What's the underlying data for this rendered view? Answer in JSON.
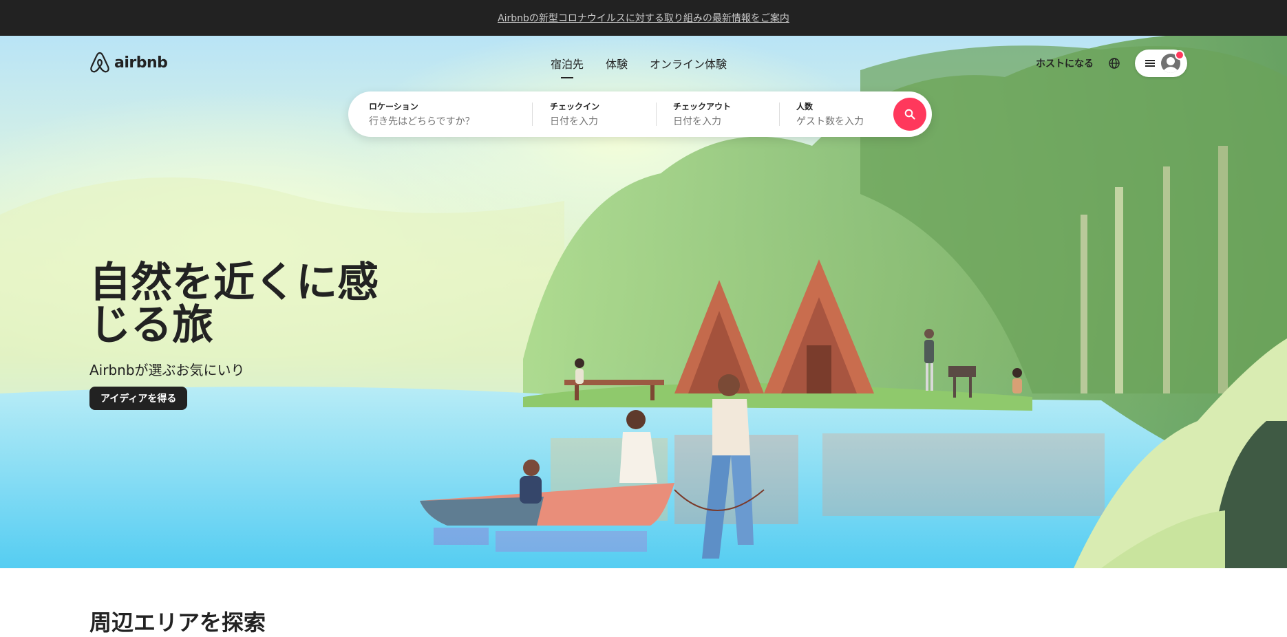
{
  "announcement": {
    "text": "Airbnbの新型コロナウイルスに対する取り組みの最新情報をご案内"
  },
  "header": {
    "logo_text": "airbnb",
    "tabs": [
      {
        "label": "宿泊先",
        "active": true
      },
      {
        "label": "体験",
        "active": false
      },
      {
        "label": "オンライン体験",
        "active": false
      }
    ],
    "host_link": "ホストになる",
    "globe_icon": "globe-icon",
    "menu_icon": "hamburger-menu-icon",
    "avatar_icon": "user-avatar-icon"
  },
  "search": {
    "fields": [
      {
        "label": "ロケーション",
        "placeholder": "行き先はどちらですか？"
      },
      {
        "label": "チェックイン",
        "placeholder": "日付を入力"
      },
      {
        "label": "チェックアウト",
        "placeholder": "日付を入力"
      },
      {
        "label": "人数",
        "placeholder": "ゲスト数を入力"
      }
    ],
    "button_icon": "search-icon"
  },
  "hero": {
    "title": "自然を近くに感じる旅",
    "subtitle": "Airbnbが選ぶお気にいり",
    "cta_label": "アイディアを得る"
  },
  "below": {
    "section_title": "周辺エリアを探索"
  },
  "colors": {
    "brand": "#ff385c",
    "announce_bg": "#222222",
    "text": "#222222"
  }
}
